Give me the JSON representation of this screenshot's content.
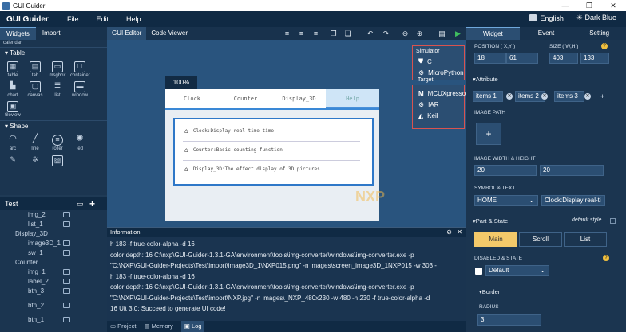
{
  "window": {
    "title": "GUI Guider",
    "min": "—",
    "max": "❐",
    "close": "✕"
  },
  "menu": {
    "brand": "GUI Guider",
    "items": [
      "File",
      "Edit",
      "Help"
    ],
    "language": "English",
    "theme": "Dark Blue"
  },
  "left": {
    "tabs": [
      "Widgets",
      "Import"
    ],
    "top_cut": "calendar",
    "sections": [
      {
        "title": "Table",
        "rows": [
          [
            "table",
            "tab",
            "msgbox",
            "container"
          ],
          [
            "chart",
            "canvas",
            "list",
            "window"
          ],
          [
            "tileview"
          ]
        ]
      },
      {
        "title": "Shape",
        "rows": [
          [
            "arc",
            "line",
            "roller",
            "led"
          ]
        ]
      }
    ],
    "tree_title": "Test",
    "tree": [
      "img_2",
      "list_1",
      "Display_3D",
      "image3D_1",
      "sw_1",
      "Counter",
      "img_1",
      "label_2",
      "btn_3",
      "btn_2",
      "btn_1"
    ]
  },
  "center": {
    "tabs": [
      "GUI Editor",
      "Code Viewer"
    ],
    "zoom": "100%",
    "screen_tabs": [
      "Clock",
      "Counter",
      "Display_3D",
      "Help"
    ],
    "help_rows": [
      "Clock:Display real-time time",
      "Counter:Basic counting function",
      "Display_3D:The effect display of 3D pictures"
    ],
    "watermark": "NXP"
  },
  "popup": {
    "simulator_title": "Simulator",
    "simulator": [
      "C",
      "MicroPython"
    ],
    "target_title": "Target",
    "target": [
      "MCUXpresso",
      "IAR",
      "Keil"
    ]
  },
  "info": {
    "title": "Information",
    "lines": [
      "h 183 -f true-color-alpha -d 16",
      "color depth: 16 C:\\nxp\\GUI-Guider-1.3.1-GA\\environment\\tools\\img-converter\\windows\\img-converter.exe -p",
      "\"C:\\NXP\\GUI-Guider-Projects\\Test\\import\\image3D_1\\NXP015.png\" -n images\\screen_image3D_1NXP015 -w 303 -",
      "h 183 -f true-color-alpha -d 16",
      "color depth: 16 C:\\nxp\\GUI-Guider-1.3.1-GA\\environment\\tools\\img-converter\\windows\\img-converter.exe -p",
      "\"C:\\NXP\\GUI-Guider-Projects\\Test\\import\\NXP.jpg\" -n images\\_NXP_480x230 -w 480 -h 230 -f true-color-alpha -d",
      "16 Uit 3.0: Succeed to generate UI code!"
    ],
    "bottom_tabs": [
      "Project",
      "Memory",
      "Log"
    ]
  },
  "right": {
    "tabs": [
      "Widget",
      "Event",
      "Setting"
    ],
    "position_label": "POSITION ( X,Y )",
    "pos_x": "18",
    "pos_y": "61",
    "size_label": "SIZE ( W,H )",
    "size_w": "403",
    "size_h": "133",
    "attribute_label": "Attribute",
    "items": [
      "items 1",
      "items 2",
      "items 3"
    ],
    "add_item": "+",
    "image_path_label": "IMAGE PATH",
    "image_add": "+",
    "image_wh_label": "IMAGE WIDTH & HEIGHT",
    "img_w": "20",
    "img_h": "20",
    "symbol_label": "SYMBOL & TEXT",
    "symbol": "HOME",
    "text": "Clock:Display real-ti",
    "part_state_label": "Part & State",
    "default_style": "default style",
    "part_buttons": [
      "Main",
      "Scroll",
      "List"
    ],
    "disabled_label": "DISABLED & STATE",
    "state": "Default",
    "border_label": "Border",
    "radius_label": "RADIUS",
    "radius": "3"
  }
}
